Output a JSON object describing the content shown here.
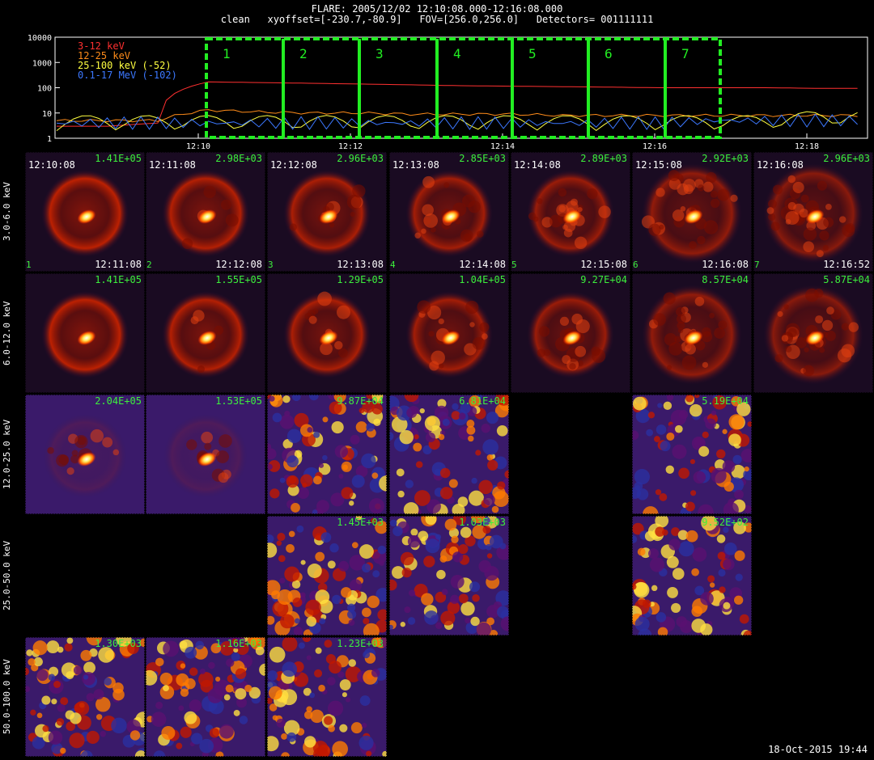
{
  "header": {
    "line1": "FLARE: 2005/12/02 12:10:08.000-12:16:08.000",
    "line2": "clean   xyoffset=[-230.7,-80.9]   FOV=[256.0,256.0]   Detectors= 001111111"
  },
  "footer": {
    "date": "18-Oct-2015 19:44"
  },
  "colors": {
    "band1": "#ff3030",
    "band2": "#ff8c1a",
    "band3": "#ffff40",
    "band4": "#3c78ff",
    "interval": "#22ee22"
  },
  "chart_data": {
    "type": "line",
    "yscale": "log",
    "ylim": [
      1,
      10000
    ],
    "yticks": [
      "1",
      "10",
      "100",
      "1000",
      "10000"
    ],
    "xlabels": [
      "12:10",
      "12:12",
      "12:14",
      "12:16",
      "12:18"
    ],
    "series": [
      {
        "name": "3-12 keV",
        "values": [
          3,
          3,
          4,
          170,
          160,
          150,
          140,
          130,
          120,
          115,
          110,
          105,
          100,
          100,
          100,
          95,
          95
        ]
      },
      {
        "name": "12-25 keV",
        "values": [
          5,
          5,
          5,
          13,
          11,
          10,
          10,
          9,
          9,
          9,
          8,
          8,
          8,
          8,
          8,
          8,
          8
        ]
      },
      {
        "name": "25-100 keV (-52)",
        "values": [
          2,
          2,
          2,
          2,
          2,
          2,
          2,
          2,
          2,
          2,
          2,
          2,
          2,
          2,
          2,
          3,
          3
        ]
      },
      {
        "name": "0.1-17 MeV (-102)",
        "values": [
          4,
          4,
          4,
          4,
          4,
          4,
          4,
          4,
          4,
          4,
          4,
          4,
          4,
          5,
          5,
          5,
          5
        ]
      }
    ],
    "intervals": [
      "1",
      "2",
      "3",
      "4",
      "5",
      "6",
      "7"
    ]
  },
  "grid": {
    "rows": [
      {
        "label": "3.0-6.0 keV",
        "cells": [
          {
            "col": 0,
            "peak": "1.41E+05",
            "start": "12:10:08",
            "end": "12:11:08",
            "idx": "1"
          },
          {
            "col": 1,
            "peak": "2.98E+03",
            "start": "12:11:08",
            "end": "12:12:08",
            "idx": "2"
          },
          {
            "col": 2,
            "peak": "2.96E+03",
            "start": "12:12:08",
            "end": "12:13:08",
            "idx": "3"
          },
          {
            "col": 3,
            "peak": "2.85E+03",
            "start": "12:13:08",
            "end": "12:14:08",
            "idx": "4"
          },
          {
            "col": 4,
            "peak": "2.89E+03",
            "start": "12:14:08",
            "end": "12:15:08",
            "idx": "5"
          },
          {
            "col": 5,
            "peak": "2.92E+03",
            "start": "12:15:08",
            "end": "12:16:08",
            "idx": "6"
          },
          {
            "col": 6,
            "peak": "2.96E+03",
            "start": "12:16:08",
            "end": "12:16:52",
            "idx": "7"
          }
        ]
      },
      {
        "label": "6.0-12.0 keV",
        "cells": [
          {
            "col": 0,
            "peak": "1.41E+05"
          },
          {
            "col": 1,
            "peak": "1.55E+05"
          },
          {
            "col": 2,
            "peak": "1.29E+05"
          },
          {
            "col": 3,
            "peak": "1.04E+05"
          },
          {
            "col": 4,
            "peak": "9.27E+04"
          },
          {
            "col": 5,
            "peak": "8.57E+04"
          },
          {
            "col": 6,
            "peak": "5.87E+04"
          }
        ]
      },
      {
        "label": "12.0-25.0 keV",
        "cells": [
          {
            "col": 0,
            "peak": "2.04E+05"
          },
          {
            "col": 1,
            "peak": "1.53E+05"
          },
          {
            "col": 2,
            "peak": "9.87E+04"
          },
          {
            "col": 3,
            "peak": "6.81E+04"
          },
          {
            "col": 5,
            "peak": "5.19E+04"
          }
        ]
      },
      {
        "label": "25.0-50.0 keV",
        "cells": [
          {
            "col": 2,
            "peak": "1.45E+03"
          },
          {
            "col": 3,
            "peak": "1.03E+03"
          },
          {
            "col": 5,
            "peak": "9.52E+02"
          }
        ]
      },
      {
        "label": "50.0-100.0 keV",
        "cells": [
          {
            "col": 0,
            "peak": "1.30E+03"
          },
          {
            "col": 1,
            "peak": "1.16E+03"
          },
          {
            "col": 2,
            "peak": "1.23E+03"
          }
        ]
      }
    ]
  }
}
